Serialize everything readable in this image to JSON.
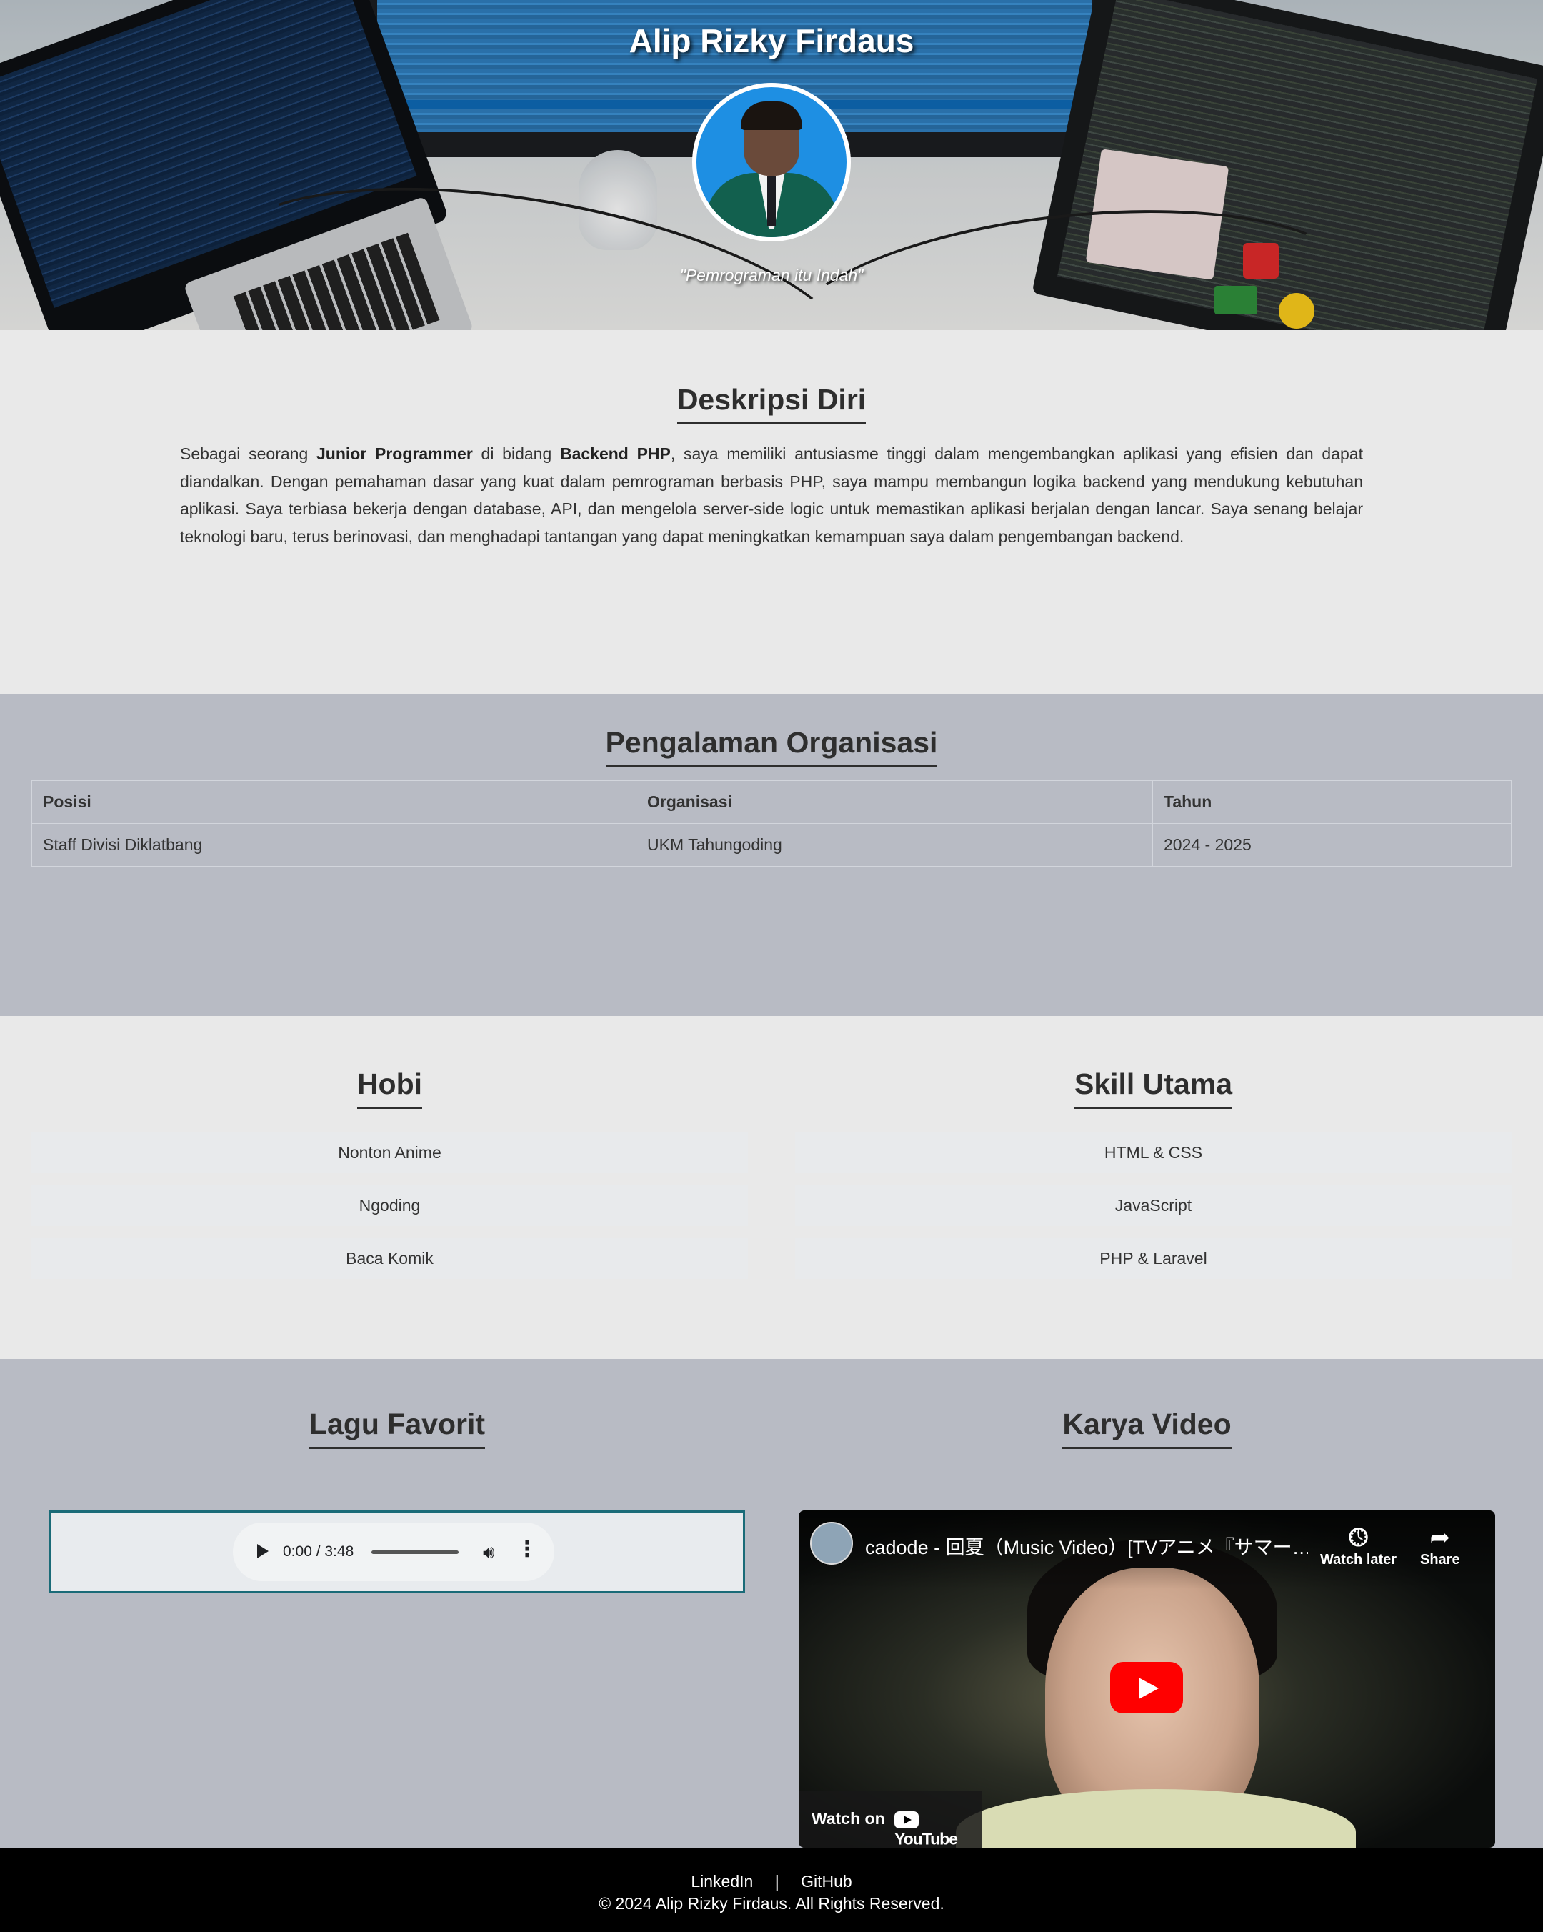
{
  "hero": {
    "name": "Alip Rizky Firdaus",
    "quote": "\"Pemrograman itu Indah\""
  },
  "description": {
    "title": "Deskripsi Diri",
    "text_1": "Sebagai seorang ",
    "bold_1": "Junior Programmer",
    "text_2": " di bidang ",
    "bold_2": "Backend PHP",
    "text_3": ", saya memiliki antusiasme tinggi dalam mengembangkan aplikasi yang efisien dan dapat diandalkan. Dengan pemahaman dasar yang kuat dalam pemrograman berbasis PHP, saya mampu membangun logika backend yang mendukung kebutuhan aplikasi. Saya terbiasa bekerja dengan database, API, dan mengelola server-side logic untuk memastikan aplikasi berjalan dengan lancar. Saya senang belajar teknologi baru, terus berinovasi, dan menghadapi tantangan yang dapat meningkatkan kemampuan saya dalam pengembangan backend."
  },
  "organization": {
    "title": "Pengalaman Organisasi",
    "headers": [
      "Posisi",
      "Organisasi",
      "Tahun"
    ],
    "rows": [
      [
        "Staff Divisi Diklatbang",
        "UKM Tahungoding",
        "2024 - 2025"
      ]
    ]
  },
  "hobbies": {
    "title": "Hobi",
    "items": [
      "Nonton Anime",
      "Ngoding",
      "Baca Komik"
    ]
  },
  "skills": {
    "title": "Skill Utama",
    "items": [
      "HTML & CSS",
      "JavaScript",
      "PHP & Laravel"
    ]
  },
  "music": {
    "title": "Lagu Favorit",
    "time": "0:00 / 3:48"
  },
  "video": {
    "title": "Karya Video",
    "video_title": "cadode - 回夏（Music Video）[TVアニメ『サマー…",
    "watch_later": "Watch later",
    "share": "Share",
    "watch_on": "Watch on",
    "youtube": "YouTube"
  },
  "footer": {
    "linkedin": "LinkedIn",
    "separator": "|",
    "github": "GitHub",
    "copyright": "© 2024 Alip Rizky Firdaus. All Rights Reserved."
  }
}
